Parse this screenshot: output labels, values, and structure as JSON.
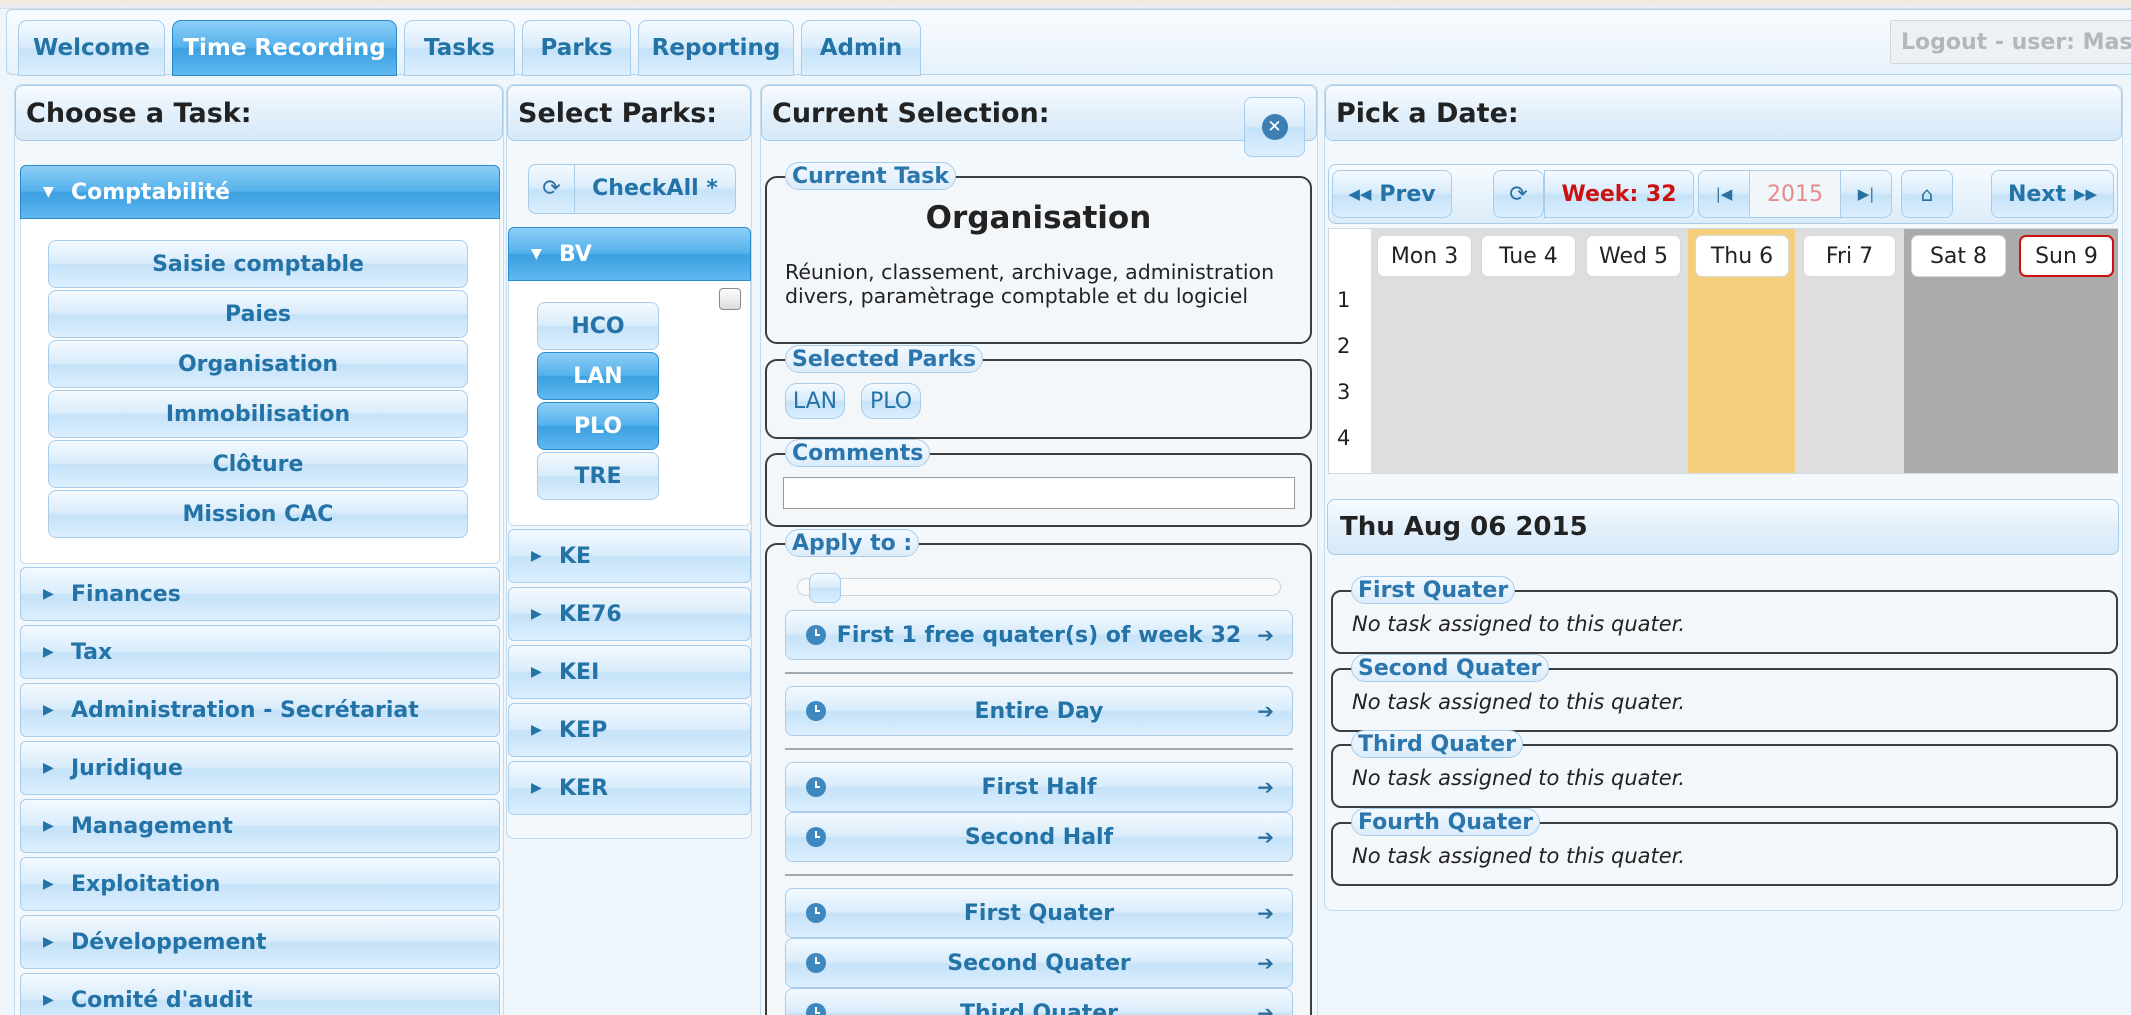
{
  "tabs": [
    {
      "label": "Welcome",
      "active": false
    },
    {
      "label": "Time Recording",
      "active": true
    },
    {
      "label": "Tasks",
      "active": false
    },
    {
      "label": "Parks",
      "active": false
    },
    {
      "label": "Reporting",
      "active": false
    },
    {
      "label": "Admin",
      "active": false
    }
  ],
  "logout": "Logout - user: Master",
  "task_panel": {
    "title": "Choose a Task:",
    "open_group": "Comptabilité",
    "open_items": [
      "Saisie comptable",
      "Paies",
      "Organisation",
      "Immobilisation",
      "Clôture",
      "Mission CAC"
    ],
    "active_item": "Organisation",
    "groups": [
      "Finances",
      "Tax",
      "Administration - Secrétariat",
      "Juridique",
      "Management",
      "Exploitation",
      "Développement",
      "Comité d'audit"
    ]
  },
  "parks_panel": {
    "title": "Select Parks:",
    "check_all": "CheckAll *",
    "open_group": "BV",
    "open_items": [
      {
        "label": "HCO",
        "selected": false
      },
      {
        "label": "LAN",
        "selected": true
      },
      {
        "label": "PLO",
        "selected": true
      },
      {
        "label": "TRE",
        "selected": false
      }
    ],
    "groups": [
      "KE",
      "KE76",
      "KEI",
      "KEP",
      "KER"
    ]
  },
  "selection_panel": {
    "title": "Current Selection:",
    "current_task_legend": "Current Task",
    "task_name": "Organisation",
    "task_description": "Réunion, classement, archivage, administration divers, paramètrage comptable et du logiciel",
    "selected_parks_legend": "Selected Parks",
    "selected_parks": [
      "LAN",
      "PLO"
    ],
    "comments_legend": "Comments",
    "comments_value": "",
    "apply_legend": "Apply to :",
    "slider_value": 0,
    "apply_buttons": {
      "free": "First 1 free quater(s) of week 32",
      "entire": "Entire Day",
      "first_half": "First Half",
      "second_half": "Second Half",
      "first_quater": "First Quater",
      "second_quater": "Second Quater",
      "third_quater": "Third Quater"
    }
  },
  "date_panel": {
    "title": "Pick a Date:",
    "prev": "Prev",
    "week": "Week: 32",
    "year": "2015",
    "next": "Next",
    "days": [
      {
        "label": "Mon 3"
      },
      {
        "label": "Tue 4"
      },
      {
        "label": "Wed 5"
      },
      {
        "label": "Thu 6",
        "selected": true
      },
      {
        "label": "Fri 7"
      },
      {
        "label": "Sat 8"
      },
      {
        "label": "Sun 9"
      }
    ],
    "hours": [
      "1",
      "2",
      "3",
      "4"
    ],
    "colors": {
      "weekday": "#dedede",
      "selected": "#f6cf7c",
      "weekend": "#ababab",
      "week_red": "#cc1111",
      "sunday_border": "#cc1111"
    },
    "detail_title": "Thu Aug 06 2015",
    "quaters": [
      {
        "label": "First Quater",
        "message": "No task assigned to this quater."
      },
      {
        "label": "Second Quater",
        "message": "No task assigned to this quater."
      },
      {
        "label": "Third Quater",
        "message": "No task assigned to this quater."
      },
      {
        "label": "Fourth Quater",
        "message": "No task assigned to this quater."
      }
    ]
  }
}
